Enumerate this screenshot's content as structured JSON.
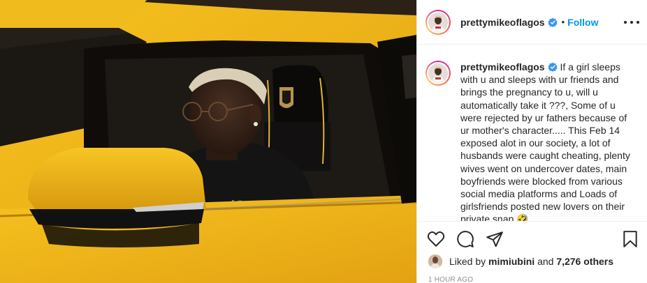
{
  "post": {
    "username": "prettymikeoflagos",
    "follow_label": "Follow",
    "separator": "•",
    "caption": "If a girl sleeps with u and sleeps with ur friends and brings the pregnancy to u, will u automatically take it ???, Some of u were rejected by ur fathers because of ur mother's character..... This Feb 14 exposed alot in our society, a lot of husbands were caught cheating, plenty wives went on undercover dates, main boyfriends were blocked from various social media platforms and Loads of girlsfriends posted new lovers on their private snap 🤣",
    "liked_by_prefix": "Liked by",
    "liked_by_user": "mimiubini",
    "and_word": "and",
    "others_count": "7,276 others",
    "timestamp": "1 HOUR AGO",
    "photo_shirt_text": "ared?"
  },
  "icons": {
    "verified": "verified-badge-icon",
    "more": "more-options-icon",
    "like": "heart-icon",
    "comment": "comment-icon",
    "share": "paper-plane-icon",
    "save": "bookmark-icon"
  },
  "colors": {
    "accent": "#0095f6",
    "car_yellow": "#f1b31c",
    "text": "#262626",
    "muted": "#8e8e8e"
  }
}
